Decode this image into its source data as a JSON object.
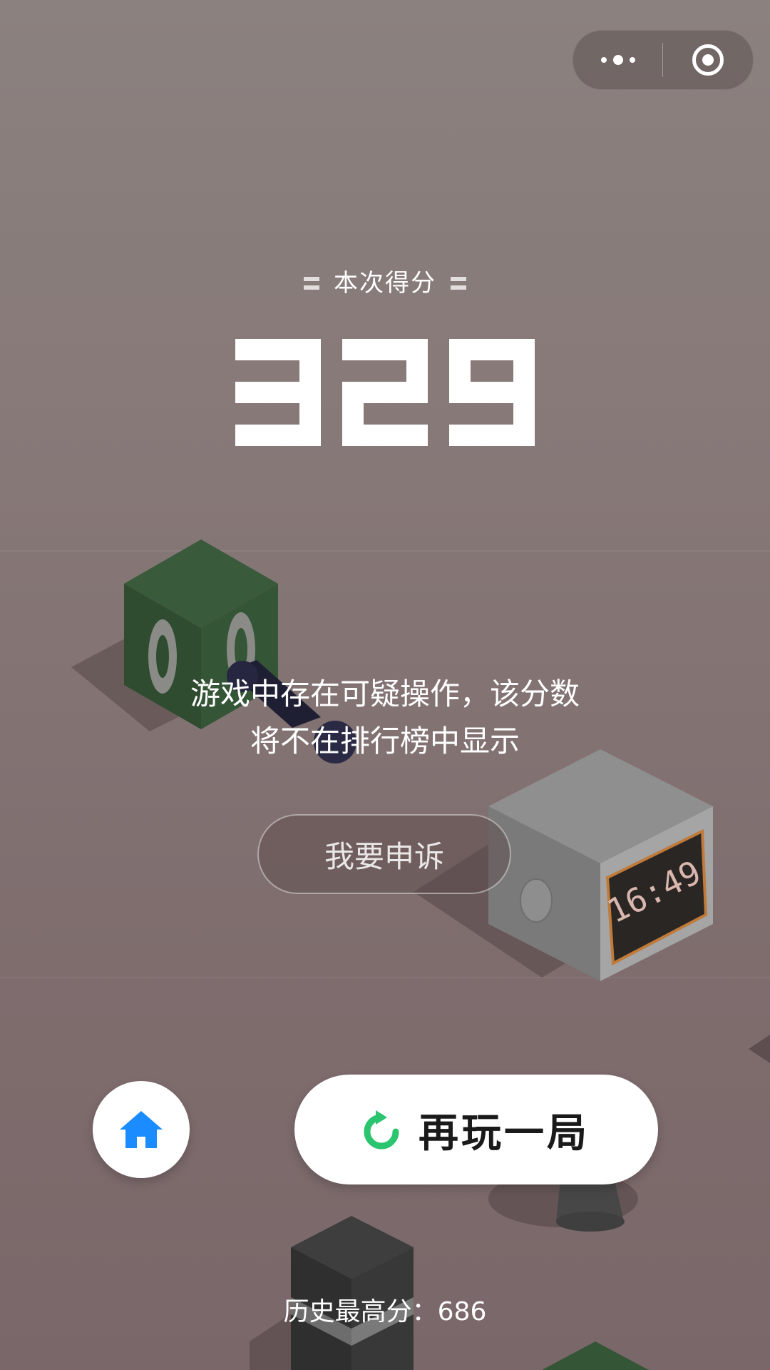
{
  "capsule": {
    "more_icon": "more-dots-icon",
    "close_icon": "target-circle-icon"
  },
  "score": {
    "label": "本次得分",
    "value": "329"
  },
  "message": {
    "line1": "游戏中存在可疑操作，该分数",
    "line2": "将不在排行榜中显示"
  },
  "appeal_button": {
    "label": "我要申诉"
  },
  "home_button": {
    "icon": "home-icon"
  },
  "replay_button": {
    "label": "再玩一局",
    "icon": "replay-arrow-icon"
  },
  "best_score": {
    "text": "历史最高分：686"
  },
  "scene": {
    "clock_display": "16:49"
  },
  "colors": {
    "background": "#867877",
    "accent_blue": "#1a8cff",
    "accent_green": "#2bc46f",
    "white": "#ffffff"
  }
}
